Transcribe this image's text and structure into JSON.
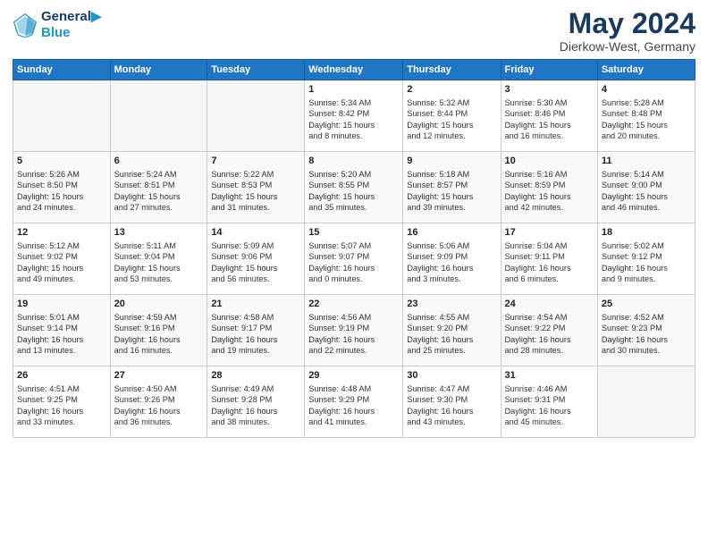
{
  "logo": {
    "line1": "General",
    "line2": "Blue"
  },
  "title": "May 2024",
  "location": "Dierkow-West, Germany",
  "days_of_week": [
    "Sunday",
    "Monday",
    "Tuesday",
    "Wednesday",
    "Thursday",
    "Friday",
    "Saturday"
  ],
  "weeks": [
    [
      {
        "day": "",
        "info": ""
      },
      {
        "day": "",
        "info": ""
      },
      {
        "day": "",
        "info": ""
      },
      {
        "day": "1",
        "info": "Sunrise: 5:34 AM\nSunset: 8:42 PM\nDaylight: 15 hours\nand 8 minutes."
      },
      {
        "day": "2",
        "info": "Sunrise: 5:32 AM\nSunset: 8:44 PM\nDaylight: 15 hours\nand 12 minutes."
      },
      {
        "day": "3",
        "info": "Sunrise: 5:30 AM\nSunset: 8:46 PM\nDaylight: 15 hours\nand 16 minutes."
      },
      {
        "day": "4",
        "info": "Sunrise: 5:28 AM\nSunset: 8:48 PM\nDaylight: 15 hours\nand 20 minutes."
      }
    ],
    [
      {
        "day": "5",
        "info": "Sunrise: 5:26 AM\nSunset: 8:50 PM\nDaylight: 15 hours\nand 24 minutes."
      },
      {
        "day": "6",
        "info": "Sunrise: 5:24 AM\nSunset: 8:51 PM\nDaylight: 15 hours\nand 27 minutes."
      },
      {
        "day": "7",
        "info": "Sunrise: 5:22 AM\nSunset: 8:53 PM\nDaylight: 15 hours\nand 31 minutes."
      },
      {
        "day": "8",
        "info": "Sunrise: 5:20 AM\nSunset: 8:55 PM\nDaylight: 15 hours\nand 35 minutes."
      },
      {
        "day": "9",
        "info": "Sunrise: 5:18 AM\nSunset: 8:57 PM\nDaylight: 15 hours\nand 39 minutes."
      },
      {
        "day": "10",
        "info": "Sunrise: 5:16 AM\nSunset: 8:59 PM\nDaylight: 15 hours\nand 42 minutes."
      },
      {
        "day": "11",
        "info": "Sunrise: 5:14 AM\nSunset: 9:00 PM\nDaylight: 15 hours\nand 46 minutes."
      }
    ],
    [
      {
        "day": "12",
        "info": "Sunrise: 5:12 AM\nSunset: 9:02 PM\nDaylight: 15 hours\nand 49 minutes."
      },
      {
        "day": "13",
        "info": "Sunrise: 5:11 AM\nSunset: 9:04 PM\nDaylight: 15 hours\nand 53 minutes."
      },
      {
        "day": "14",
        "info": "Sunrise: 5:09 AM\nSunset: 9:06 PM\nDaylight: 15 hours\nand 56 minutes."
      },
      {
        "day": "15",
        "info": "Sunrise: 5:07 AM\nSunset: 9:07 PM\nDaylight: 16 hours\nand 0 minutes."
      },
      {
        "day": "16",
        "info": "Sunrise: 5:06 AM\nSunset: 9:09 PM\nDaylight: 16 hours\nand 3 minutes."
      },
      {
        "day": "17",
        "info": "Sunrise: 5:04 AM\nSunset: 9:11 PM\nDaylight: 16 hours\nand 6 minutes."
      },
      {
        "day": "18",
        "info": "Sunrise: 5:02 AM\nSunset: 9:12 PM\nDaylight: 16 hours\nand 9 minutes."
      }
    ],
    [
      {
        "day": "19",
        "info": "Sunrise: 5:01 AM\nSunset: 9:14 PM\nDaylight: 16 hours\nand 13 minutes."
      },
      {
        "day": "20",
        "info": "Sunrise: 4:59 AM\nSunset: 9:16 PM\nDaylight: 16 hours\nand 16 minutes."
      },
      {
        "day": "21",
        "info": "Sunrise: 4:58 AM\nSunset: 9:17 PM\nDaylight: 16 hours\nand 19 minutes."
      },
      {
        "day": "22",
        "info": "Sunrise: 4:56 AM\nSunset: 9:19 PM\nDaylight: 16 hours\nand 22 minutes."
      },
      {
        "day": "23",
        "info": "Sunrise: 4:55 AM\nSunset: 9:20 PM\nDaylight: 16 hours\nand 25 minutes."
      },
      {
        "day": "24",
        "info": "Sunrise: 4:54 AM\nSunset: 9:22 PM\nDaylight: 16 hours\nand 28 minutes."
      },
      {
        "day": "25",
        "info": "Sunrise: 4:52 AM\nSunset: 9:23 PM\nDaylight: 16 hours\nand 30 minutes."
      }
    ],
    [
      {
        "day": "26",
        "info": "Sunrise: 4:51 AM\nSunset: 9:25 PM\nDaylight: 16 hours\nand 33 minutes."
      },
      {
        "day": "27",
        "info": "Sunrise: 4:50 AM\nSunset: 9:26 PM\nDaylight: 16 hours\nand 36 minutes."
      },
      {
        "day": "28",
        "info": "Sunrise: 4:49 AM\nSunset: 9:28 PM\nDaylight: 16 hours\nand 38 minutes."
      },
      {
        "day": "29",
        "info": "Sunrise: 4:48 AM\nSunset: 9:29 PM\nDaylight: 16 hours\nand 41 minutes."
      },
      {
        "day": "30",
        "info": "Sunrise: 4:47 AM\nSunset: 9:30 PM\nDaylight: 16 hours\nand 43 minutes."
      },
      {
        "day": "31",
        "info": "Sunrise: 4:46 AM\nSunset: 9:31 PM\nDaylight: 16 hours\nand 45 minutes."
      },
      {
        "day": "",
        "info": ""
      }
    ]
  ]
}
